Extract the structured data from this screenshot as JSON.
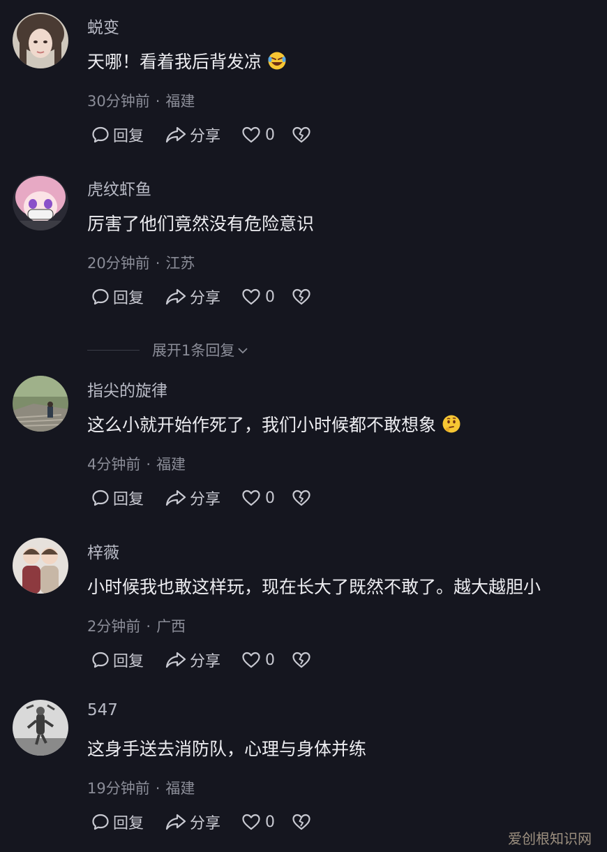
{
  "comments": [
    {
      "username": "蜕变",
      "text": "天哪！看着我后背发凉",
      "emoji": "rolling-laughing-emoji",
      "time": "30分钟前",
      "location": "福建",
      "reply_label": "回复",
      "share_label": "分享",
      "like_count": "0"
    },
    {
      "username": "虎纹虾鱼",
      "text": "厉害了他们竟然没有危险意识",
      "time": "20分钟前",
      "location": "江苏",
      "reply_label": "回复",
      "share_label": "分享",
      "like_count": "0"
    },
    {
      "username": "指尖的旋律",
      "text": "这么小就开始作死了，我们小时候都不敢想象",
      "emoji": "thinking-emoji",
      "time": "4分钟前",
      "location": "福建",
      "reply_label": "回复",
      "share_label": "分享",
      "like_count": "0"
    },
    {
      "username": "梓薇",
      "text": "小时候我也敢这样玩，现在长大了既然不敢了。越大越胆小",
      "time": "2分钟前",
      "location": "广西",
      "reply_label": "回复",
      "share_label": "分享",
      "like_count": "0"
    },
    {
      "username": "547",
      "text": "这身手送去消防队，心理与身体并练",
      "time": "19分钟前",
      "location": "福建",
      "reply_label": "回复",
      "share_label": "分享",
      "like_count": "0"
    }
  ],
  "expand_replies_label": "展开1条回复",
  "meta_separator": "·",
  "watermark": "爱创根知识网",
  "colors": {
    "background": "#15161f",
    "text": "#ededf1",
    "muted": "#8b8d98"
  }
}
